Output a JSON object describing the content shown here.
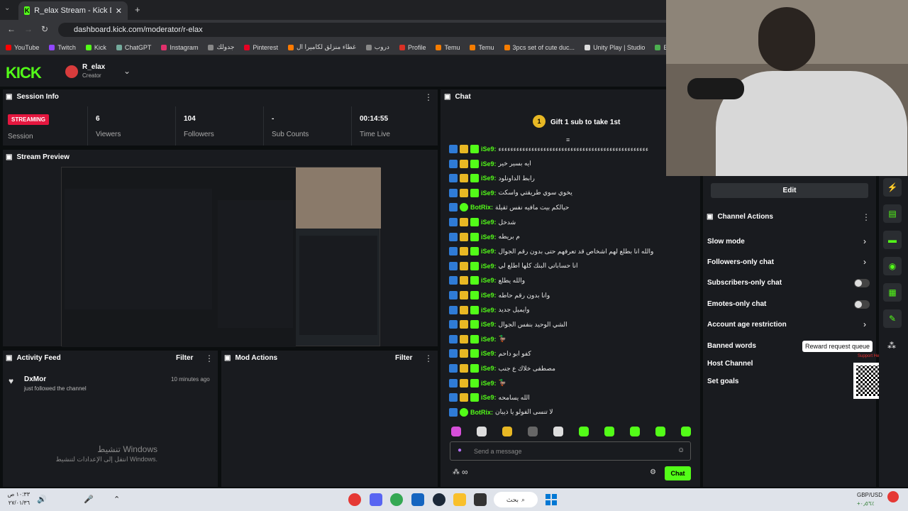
{
  "browser": {
    "tab_title": "R_elax Stream - Kick Dashboard",
    "url": "dashboard.kick.com/moderator/r-elax",
    "bookmarks": [
      "YouTube",
      "Twitch",
      "Kick",
      "ChatGPT",
      "Instagram",
      "جدولك",
      "Pinterest",
      "غطاء منزلق لكاميرا ال",
      "دروب",
      "Profile",
      "Temu",
      "Temu",
      "3pcs set of cute duc...",
      "Unity Play | Studio",
      "EveryCircuit"
    ]
  },
  "header": {
    "logo": "KICK",
    "channel_name": "R_elax",
    "channel_role": "Creator"
  },
  "session": {
    "title": "Session Info",
    "status_badge": "STREAMING",
    "status_label": "Session",
    "stats": [
      {
        "value": "6",
        "label": "Viewers"
      },
      {
        "value": "104",
        "label": "Followers"
      },
      {
        "value": "-",
        "label": "Sub Counts"
      },
      {
        "value": "00:14:55",
        "label": "Time Live"
      }
    ]
  },
  "preview": {
    "title": "Stream Preview"
  },
  "activity": {
    "title": "Activity Feed",
    "filter": "Filter",
    "item_user": "DxMor",
    "item_text": "just followed the channel",
    "item_time": "10 minutes ago"
  },
  "mod_actions": {
    "title": "Mod Actions",
    "filter": "Filter"
  },
  "chat": {
    "title": "Chat",
    "gift_text": "Gift 1 sub to take 1st",
    "gift_badge": "1",
    "messages": [
      {
        "user": "iSe9:",
        "text": "ءءءءءءءءءءءءءءءءءءءءءءءءءءءءءءءءءءءءءءءءءءءءءءءءءء"
      },
      {
        "user": "iSe9:",
        "text": "ايه بسير خير"
      },
      {
        "user": "iSe9:",
        "text": "رابط الداونلود"
      },
      {
        "user": "iSe9:",
        "text": "يخوي سوي طريقتي واسكت"
      },
      {
        "user": "BotRix:",
        "text": "حيالكم بيت مافيه نفس ثقيلة"
      },
      {
        "user": "iSe9:",
        "text": "شدخل"
      },
      {
        "user": "iSe9:",
        "text": "م بريطه"
      },
      {
        "user": "iSe9:",
        "text": "والله انا بطلع لهم اشخاص قد تعرفهم حتى بدون رقم الجوال"
      },
      {
        "user": "iSe9:",
        "text": "انا حساباتي البنك كلها اطلع لي"
      },
      {
        "user": "iSe9:",
        "text": "والله يطلع"
      },
      {
        "user": "iSe9:",
        "text": "وانا بدون رقم حاطه"
      },
      {
        "user": "iSe9:",
        "text": "وايميل جديد"
      },
      {
        "user": "iSe9:",
        "text": "الشي الوحيد بنفس الجوال"
      },
      {
        "user": "iSe9:",
        "text": "🦆"
      },
      {
        "user": "iSe9:",
        "text": "كفو ابو داحم"
      },
      {
        "user": "iSe9:",
        "text": "مصطفى خلاك ع جنب"
      },
      {
        "user": "iSe9:",
        "text": "🦆"
      },
      {
        "user": "iSe9:",
        "text": "الله يسامحه"
      },
      {
        "user": "BotRix:",
        "text": "لا تنسى الفولو يا ذيبان"
      }
    ],
    "input_placeholder": "Send a message",
    "send_label": "Chat",
    "infinity": "∞"
  },
  "channel_actions": {
    "edit_label": "Edit",
    "title": "Channel Actions",
    "items": [
      "Slow mode",
      "Followers-only chat",
      "Subscribers-only chat",
      "Emotes-only chat",
      "Account age restriction",
      "Banned words",
      "Host Channel",
      "Set goals"
    ],
    "tooltip": "Reward request queue",
    "support_text": "Support Here"
  },
  "desktop": {
    "watermark_title": "تنشيط Windows",
    "watermark_sub": "انتقل إلى الإعدادات لتنشيط Windows.",
    "search_text": "بحث",
    "clock_time": "١٠:٣٣ ص",
    "clock_date": "٢٧/٠١/٣٦",
    "currency": "GBP/USD",
    "currency_change": "+٠٫٥٦٪"
  },
  "colors": {
    "accent": "#53fc18",
    "bg": "#0b0e0f",
    "panel": "#191b1f",
    "streaming": "#e5173f"
  }
}
